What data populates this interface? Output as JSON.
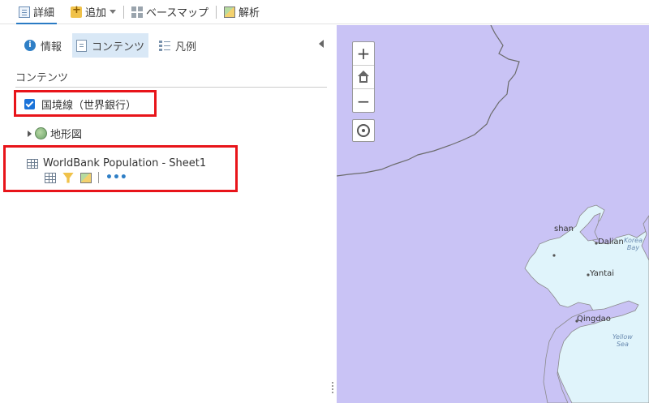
{
  "toolbar": {
    "details_label": "詳細",
    "add_label": "追加",
    "basemap_label": "ベースマップ",
    "analysis_label": "解析"
  },
  "panel": {
    "tabs": [
      {
        "label": "情報",
        "icon": "info-icon"
      },
      {
        "label": "コンテンツ",
        "icon": "content-icon",
        "active": true
      },
      {
        "label": "凡例",
        "icon": "legend-icon"
      }
    ],
    "section_title": "コンテンツ",
    "layers": [
      {
        "label": "国境線（世界銀行）",
        "checked": true
      },
      {
        "label": "地形図",
        "type": "basemap"
      },
      {
        "label": "WorldBank Population - Sheet1",
        "type": "table"
      }
    ]
  },
  "map": {
    "places": [
      {
        "name": "shan"
      },
      {
        "name": "Dalian"
      },
      {
        "name": "Yantai"
      },
      {
        "name": "Qingdao"
      }
    ],
    "seas": [
      {
        "name": "Korea Bay",
        "line1": "Korea",
        "line2": "Bay"
      },
      {
        "name": "Yellow Sea",
        "line1": "Yellow",
        "line2": "Sea"
      }
    ]
  },
  "colors": {
    "accent": "#2a7bc4",
    "highlight_border": "#e8141a",
    "map_land": "#c9c3f5",
    "map_water": "#e0f4fb"
  }
}
